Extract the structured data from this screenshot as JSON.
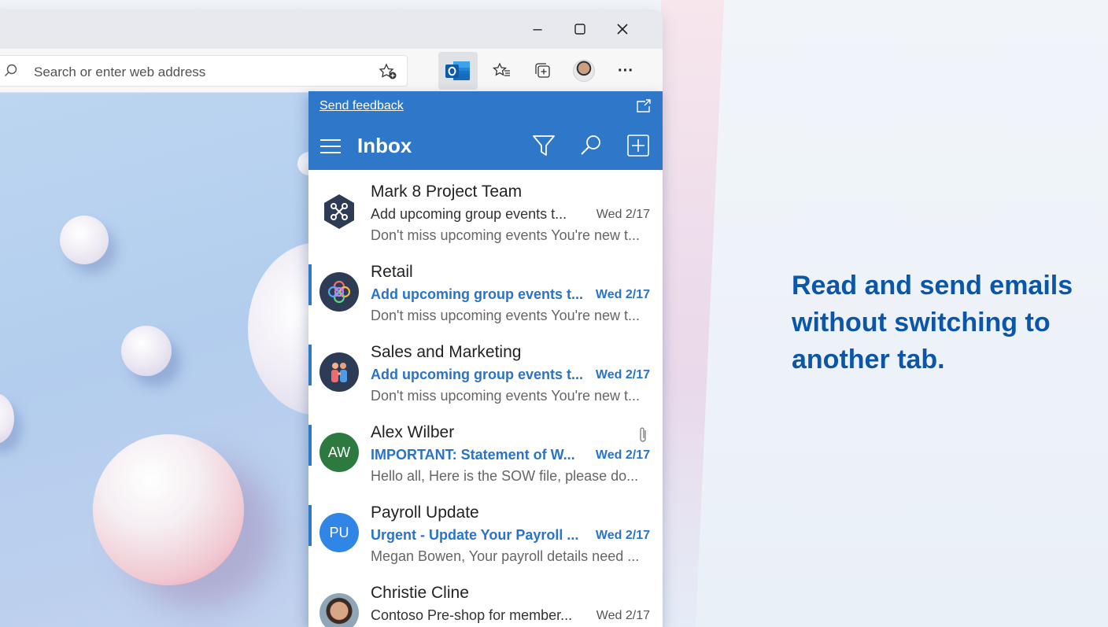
{
  "browser": {
    "window_controls": {
      "minimize": "–",
      "maximize": "☐",
      "close": "✕"
    },
    "address_bar": {
      "placeholder": "Search or enter web address"
    },
    "more_label": "···"
  },
  "outlook": {
    "send_feedback": "Send feedback",
    "folder_title": "Inbox",
    "icons": [
      "hamburger-menu-icon",
      "filter-icon",
      "search-icon",
      "new-mail-icon",
      "popout-icon"
    ],
    "accent_color": "#2f77c8",
    "messages": [
      {
        "sender": "Mark 8 Project Team",
        "subject": "Add upcoming group events t...",
        "date": "Wed 2/17",
        "preview": "Don't miss upcoming events You're new t...",
        "unread": false,
        "avatar": ""
      },
      {
        "sender": "Retail",
        "subject": "Add upcoming group events t...",
        "date": "Wed 2/17",
        "preview": "Don't miss upcoming events You're new t...",
        "unread": true,
        "avatar": ""
      },
      {
        "sender": "Sales and Marketing",
        "subject": "Add upcoming group events t...",
        "date": "Wed 2/17",
        "preview": "Don't miss upcoming events You're new t...",
        "unread": true,
        "avatar": ""
      },
      {
        "sender": "Alex Wilber",
        "subject": "IMPORTANT: Statement of W...",
        "date": "Wed 2/17",
        "preview": "Hello all, Here is the SOW file, please do...",
        "unread": true,
        "avatar": "AW",
        "attachment": true
      },
      {
        "sender": "Payroll Update",
        "subject": "Urgent - Update Your Payroll ...",
        "date": "Wed 2/17",
        "preview": "Megan Bowen, Your payroll details need ...",
        "unread": true,
        "avatar": "PU"
      },
      {
        "sender": "Christie Cline",
        "subject": "Contoso Pre-shop for member...",
        "date": "Wed 2/17",
        "preview": "",
        "unread": false,
        "avatar": ""
      }
    ]
  },
  "caption": {
    "text": "Read and send emails without switching to another tab."
  }
}
